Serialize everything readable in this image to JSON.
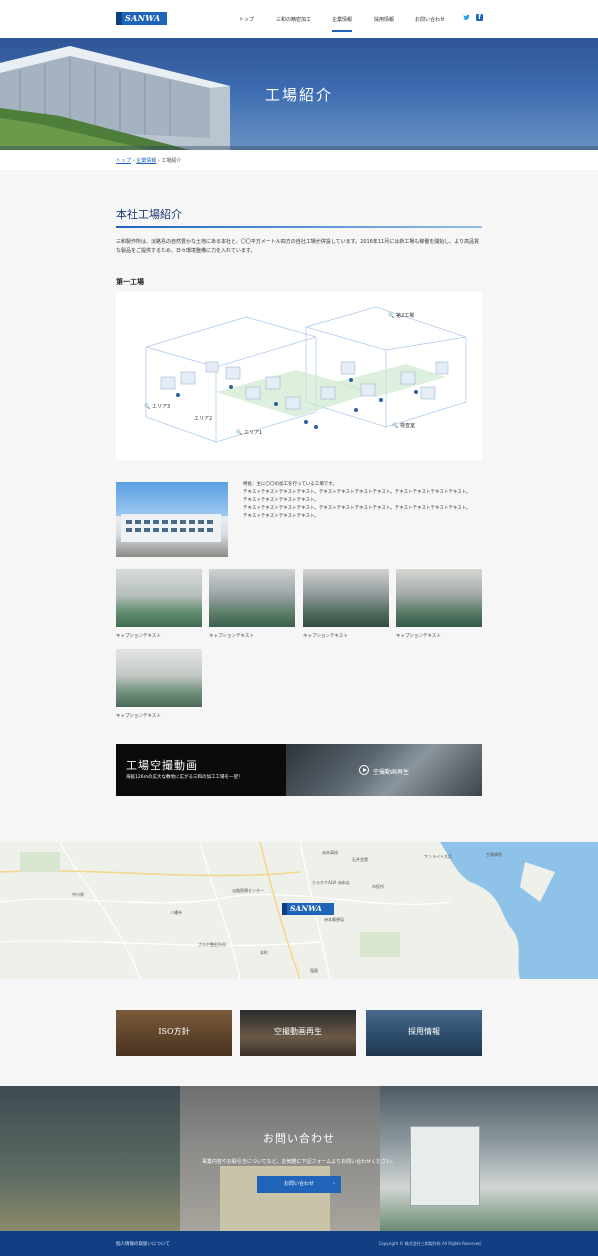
{
  "header": {
    "logo_text": "SANWA",
    "nav": [
      "トップ",
      "三和の精密加工",
      "企業情報",
      "採用情報",
      "お問い合わせ"
    ],
    "active_nav": "企業情報"
  },
  "hero": {
    "title": "工場紹介"
  },
  "breadcrumb": [
    "トップ",
    "企業情報",
    "工場紹介"
  ],
  "section": {
    "title": "本社工場紹介",
    "intro": "三和製作所は、淡路島の自然豊かな土地にある本社と、〇〇平方メートル四方の自社工場が併設しています。2016年11月には新工場も稼働を開始し、より高品質な製品をご提供するため、日々環境整備に力を入れています。",
    "factory_heading": "第一工場",
    "map_labels": [
      "第2工場",
      "エリア3",
      "エリア2",
      "エリア1",
      "検査室"
    ],
    "features": [
      "特長：主に〇〇の加工を行っている工場です。",
      "テキストテキストテキストテキスト。テキストテキストテキストテキスト。テキストテキストテキストテキスト。",
      "テキストテキストテキストテキスト。",
      "テキストテキストテキストテキスト。テキストテキストテキストテキスト。テキストテキストテキストテキスト。",
      "テキストテキストテキストテキスト。"
    ],
    "captions": [
      "キャプションテキスト",
      "キャプションテキスト",
      "キャプションテキスト",
      "キャプションテキスト",
      "キャプションテキスト"
    ]
  },
  "video_banner": {
    "title": "工場空撮動画",
    "subtitle": "海抜126mの広大な敷地に広がる三和の加工工場を一望！",
    "play_label": "空撮動画再生"
  },
  "map": {
    "pin_text": "SANWA",
    "labels": [
      "洲本高校",
      "石井会館",
      "サンライト大浜",
      "生陽病院",
      "カラオケALVI 洲本店",
      "市役所",
      "洲本郵便局",
      "中川原",
      "八幡寺",
      "さわや整形外科",
      "本町",
      "淡路医療センター",
      "塩屋"
    ]
  },
  "links": [
    "ISO方針",
    "空撮動画再生",
    "採用情報"
  ],
  "contact": {
    "title": "お問い合わせ",
    "text": "事業内容やお取引きについてなど、お気軽に下記フォームよりお問い合わせください。",
    "button": "お問い合わせ"
  },
  "footer": {
    "privacy": "個人情報の取扱いについて",
    "copyright": "Copyright © 株式会社三和製作所 All Rights Reserved."
  }
}
